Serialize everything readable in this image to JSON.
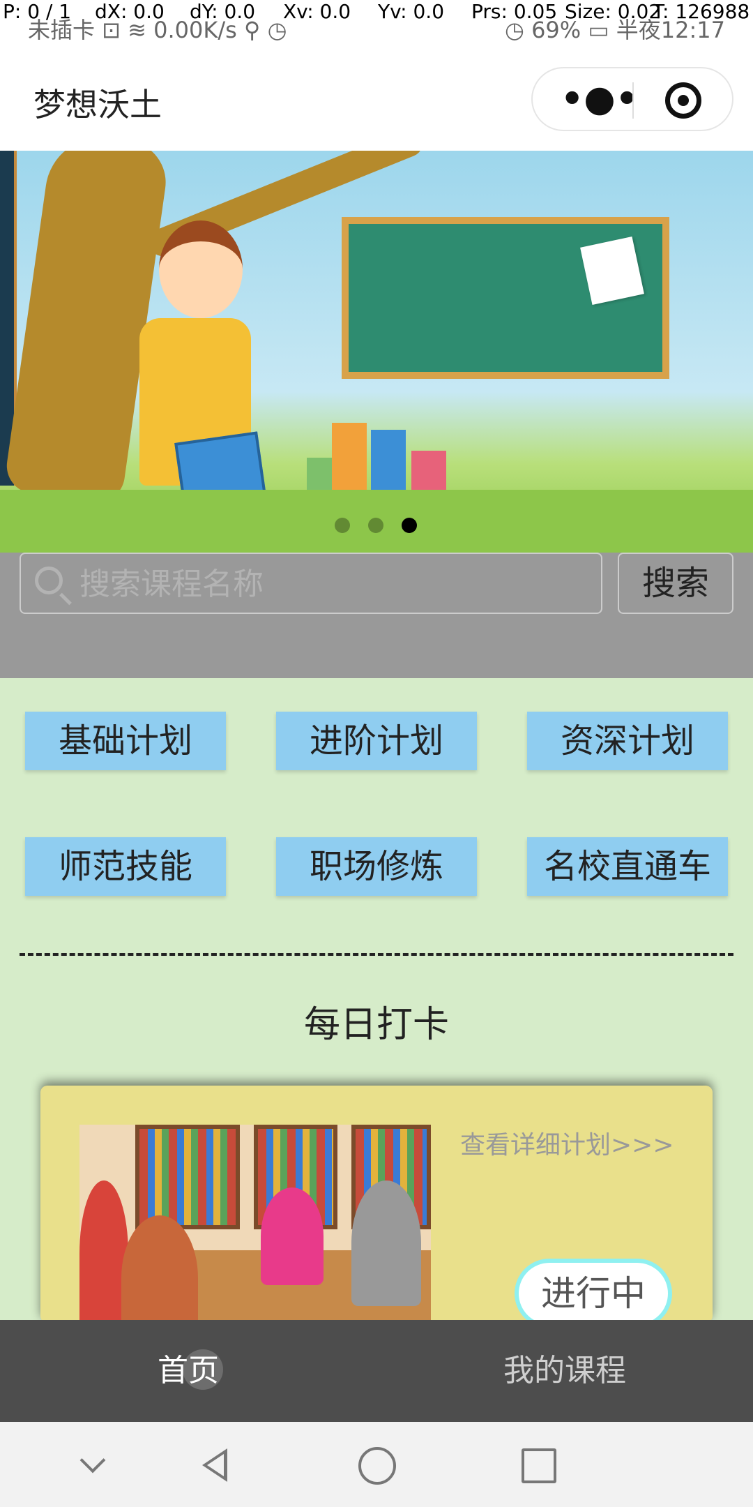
{
  "debug": {
    "p": "P: 0 / 1",
    "dx": "dX: 0.0",
    "dy": "dY: 0.0",
    "xv": "Xv: 0.0",
    "yv": "Yv: 0.0",
    "prs": "Prs: 0.05",
    "size": "Size: 0.02",
    "t": "T: 126988"
  },
  "status_bar": {
    "left": "未插卡 ⊡ ≋ 0.00K/s ⚲ ◷",
    "right": "◷ 69% ▭ 半夜12:17"
  },
  "header": {
    "title": "梦想沃土",
    "more_glyph": "•●•"
  },
  "search": {
    "placeholder": "搜索课程名称",
    "button": "搜索"
  },
  "categories": [
    "基础计划",
    "进阶计划",
    "资深计划",
    "师范技能",
    "职场修炼",
    "名校直通车"
  ],
  "checkin": {
    "title": "每日打卡",
    "detail_link": "查看详细计划>>>",
    "status": "进行中"
  },
  "tabs": {
    "home": "首页",
    "my_courses": "我的课程"
  },
  "banner": {
    "dot_count": 3,
    "active_dot": 2
  }
}
